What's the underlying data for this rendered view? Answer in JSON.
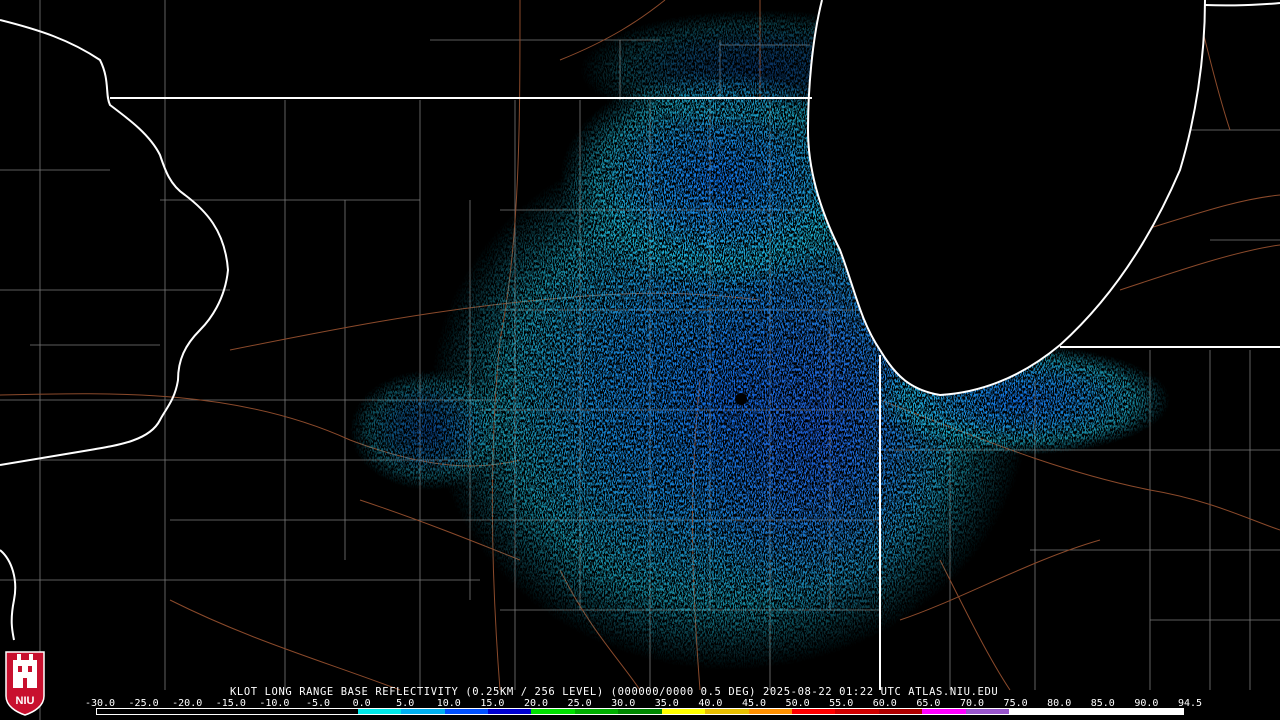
{
  "title_line": "KLOT LONG RANGE BASE REFLECTIVITY (0.25KM / 256 LEVEL) (000000/0000 0.5 DEG) 2025-08-22 01:22 UTC  ATLAS.NIU.EDU",
  "logo_text": "NIU",
  "scale": {
    "ticks": [
      "-30.0",
      "-25.0",
      "-20.0",
      "-15.0",
      "-10.0",
      "-5.0",
      "0.0",
      "5.0",
      "10.0",
      "15.0",
      "20.0",
      "25.0",
      "30.0",
      "35.0",
      "40.0",
      "45.0",
      "50.0",
      "55.0",
      "60.0",
      "65.0",
      "70.0",
      "75.0",
      "80.0",
      "85.0",
      "90.0",
      "94.5"
    ],
    "colors": [
      "#000000",
      "#000000",
      "#000000",
      "#000000",
      "#000000",
      "#000000",
      "#00e8e8",
      "#00b0f0",
      "#0050ff",
      "#0000d0",
      "#00e000",
      "#00b000",
      "#008800",
      "#ffff00",
      "#e8c000",
      "#ff9000",
      "#ff0000",
      "#d00000",
      "#b00000",
      "#ff00ff",
      "#9955cc",
      "#ffffff",
      "#ffffff",
      "#ffffff",
      "#ffffff"
    ]
  },
  "radar_site": "KLOT",
  "colors": {
    "state_border": "#ffffff",
    "county_border": "#808080",
    "road": "#8b4a2b",
    "echo_light": "#1fb8d8",
    "echo_mid": "#1080e0",
    "echo_dark": "#1040d0"
  }
}
